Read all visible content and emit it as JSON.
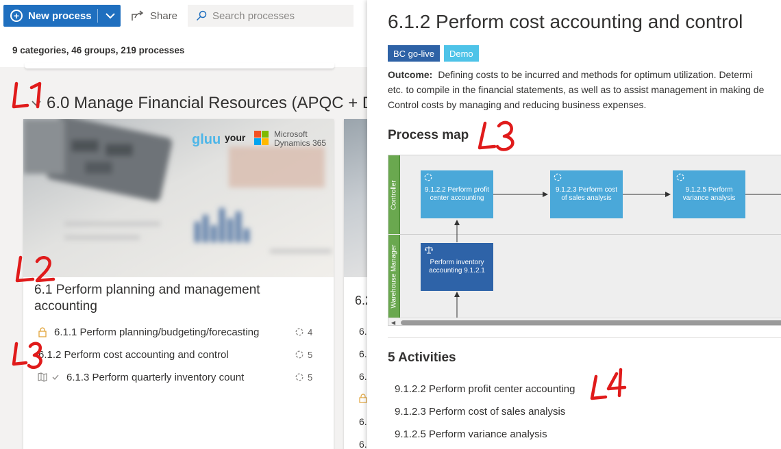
{
  "toolbar": {
    "new_label": "New process",
    "share_label": "Share",
    "search_placeholder": "Search processes"
  },
  "summary": "9 categories, 46 groups, 219 processes",
  "category": {
    "title": "6.0 Manage Financial Resources (APQC + D"
  },
  "card_image": {
    "brand": "gluu",
    "brand_suffix": "your",
    "partner_line1": "Microsoft",
    "partner_line2": "Dynamics 365"
  },
  "group": {
    "title": "6.1 Perform planning and management accounting",
    "processes": [
      {
        "label": "6.1.1 Perform planning/budgeting/forecasting",
        "count": "4",
        "icon": "lock-icon"
      },
      {
        "label": "6.1.2 Perform cost accounting and control",
        "count": "5",
        "icon": ""
      },
      {
        "label": "6.1.3 Perform quarterly inventory count",
        "count": "5",
        "icon": "map-icon"
      }
    ]
  },
  "group2": {
    "title": "6.2",
    "rows": [
      "6.",
      "6.",
      "6.",
      "6.",
      "6.",
      "6."
    ]
  },
  "detail": {
    "title": "6.1.2 Perform cost accounting and control",
    "tags": [
      "BC go-live",
      "Demo"
    ],
    "outcome_label": "Outcome:",
    "outcome_line1": "Defining costs to be incurred and methods for optimum utilization. Determi",
    "outcome_line2": "etc. to compile in the financial statements, as well as to assist management in making de",
    "outcome_line3": "Control costs by managing and reducing business expenses.",
    "process_map_heading": "Process map",
    "lanes": [
      "Controller",
      "Warehouse Manager"
    ],
    "map_activities": [
      {
        "label": "9.1.2.2 Perform profit center accounting"
      },
      {
        "label": "9.1.2.3 Perform cost of sales analysis"
      },
      {
        "label": "9.1.2.5 Perform variance analysis"
      },
      {
        "label": "Perform inventory accounting 9.1.2.1"
      }
    ],
    "activities_heading": "5 Activities",
    "activities": [
      "9.1.2.2 Perform profit center accounting",
      "9.1.2.3 Perform cost of sales analysis",
      "9.1.2.5 Perform variance analysis"
    ]
  },
  "annotations": {
    "l1": "L1",
    "l2": "L2",
    "l3a": "L3",
    "l3b": "L3",
    "l4": "L4",
    "color": "#e01b1b"
  },
  "colors": {
    "primary": "#1f6fbf",
    "tag_go_live": "#2e62a6",
    "tag_demo": "#4ec3e8",
    "activity": "#4aa8d9",
    "activity_dark": "#2e63a8",
    "lane": "#6aa84f"
  }
}
